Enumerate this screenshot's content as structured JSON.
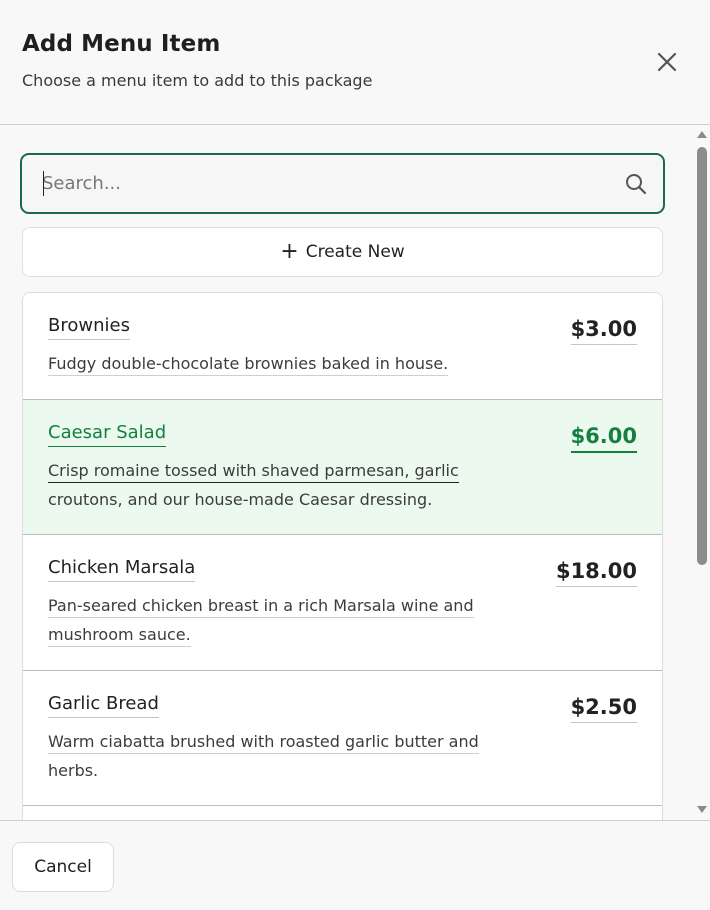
{
  "dialog": {
    "title": "Add Menu Item",
    "subtitle": "Choose a menu item to add to this package",
    "close_icon": "close-icon"
  },
  "search": {
    "placeholder": "Search...",
    "value": "",
    "icon": "search-icon"
  },
  "create_new": {
    "icon": "plus-icon",
    "plus_glyph": "+",
    "label": "Create New"
  },
  "items": [
    {
      "name": "Brownies",
      "price": "$3.00",
      "description": "Fudgy double-chocolate brownies baked in house.",
      "selected": false
    },
    {
      "name": "Caesar Salad",
      "price": "$6.00",
      "description": "Crisp romaine tossed with shaved parmesan, garlic croutons, and our house-made Caesar dressing.",
      "description_lines": [
        "Crisp romaine tossed with shaved parmesan, garlic",
        "croutons, and our house-made Caesar dressing."
      ],
      "selected": true
    },
    {
      "name": "Chicken Marsala",
      "price": "$18.00",
      "description": "Pan-seared chicken breast in a rich Marsala wine and mushroom sauce.",
      "description_lines": [
        "Pan-seared chicken breast in a rich Marsala wine and",
        "mushroom sauce."
      ],
      "selected": false
    },
    {
      "name": "Garlic Bread",
      "price": "$2.50",
      "description": "Warm ciabatta brushed with roasted garlic butter and herbs.",
      "description_lines": [
        "Warm ciabatta brushed with roasted garlic butter and",
        "herbs."
      ],
      "selected": false
    }
  ],
  "footer": {
    "cancel_label": "Cancel"
  },
  "colors": {
    "accent": "#14803f",
    "selected_bg": "#ebf9ef",
    "search_border": "#1d6b45"
  }
}
